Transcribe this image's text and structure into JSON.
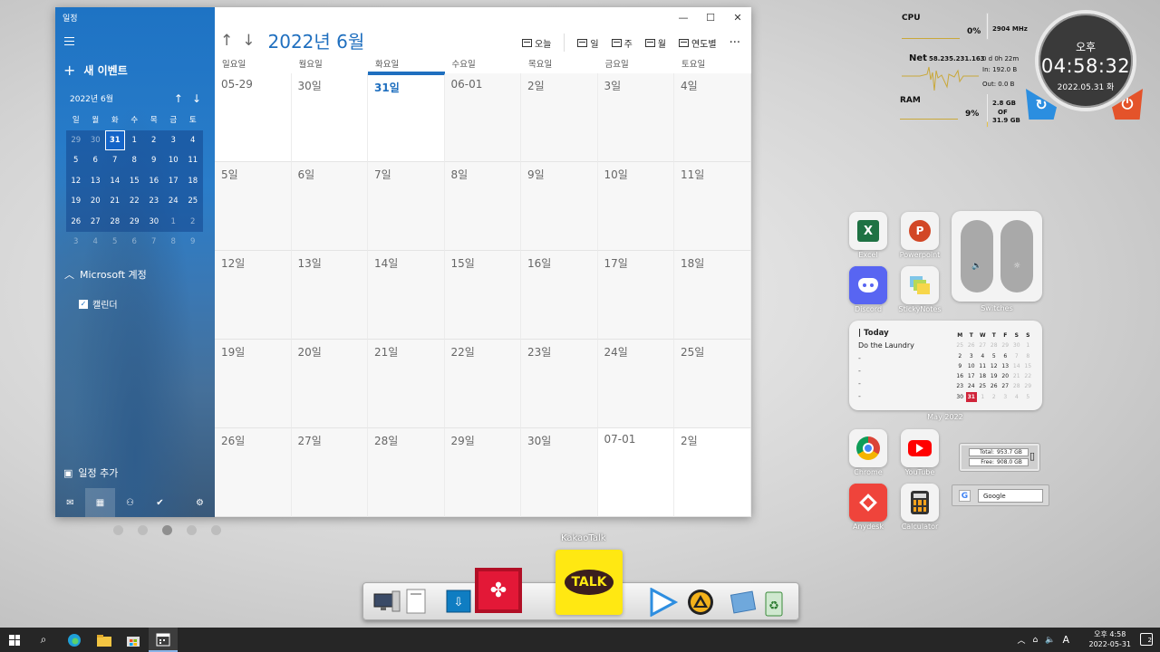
{
  "app": {
    "title": "일정"
  },
  "sidebar": {
    "new_event": "새 이벤트",
    "mini_calendar": {
      "title": "2022년 6월",
      "weekdays": [
        "일",
        "월",
        "화",
        "수",
        "목",
        "금",
        "토"
      ],
      "days": [
        "29",
        "30",
        "31",
        "1",
        "2",
        "3",
        "4",
        "5",
        "6",
        "7",
        "8",
        "9",
        "10",
        "11",
        "12",
        "13",
        "14",
        "15",
        "16",
        "17",
        "18",
        "19",
        "20",
        "21",
        "22",
        "23",
        "24",
        "25",
        "26",
        "27",
        "28",
        "29",
        "30",
        "1",
        "2",
        "3",
        "4",
        "5",
        "6",
        "7",
        "8",
        "9"
      ]
    },
    "account": "Microsoft 계정",
    "calendar_name": "캘린더",
    "add_calendar": "일정 추가"
  },
  "main": {
    "month_title": "2022년 6월",
    "toolbar": {
      "today": "오늘",
      "day": "일",
      "week": "주",
      "month": "월",
      "year": "연도별",
      "more": "···"
    },
    "weekdays": [
      "일요일",
      "월요일",
      "화요일",
      "수요일",
      "목요일",
      "금요일",
      "토요일"
    ],
    "cells": [
      "05-29",
      "30일",
      "31일",
      "06-01",
      "2일",
      "3일",
      "4일",
      "5일",
      "6일",
      "7일",
      "8일",
      "9일",
      "10일",
      "11일",
      "12일",
      "13일",
      "14일",
      "15일",
      "16일",
      "17일",
      "18일",
      "19일",
      "20일",
      "21일",
      "22일",
      "23일",
      "24일",
      "25일",
      "26일",
      "27일",
      "28일",
      "29일",
      "30일",
      "07-01",
      "2일"
    ]
  },
  "monitor": {
    "cpu_label": "CPU",
    "cpu_value": "0%",
    "cpu_freq": "2904 MHz",
    "net_label": "Net",
    "net_ip": "58.235.231.163",
    "net_uptime": "0 d 0h 22m",
    "net_in": "In: 192.0 B",
    "net_out": "Out: 0.0 B",
    "ram_label": "RAM",
    "ram_value": "9%",
    "ram_used": "2.8 GB",
    "ram_of": "OF",
    "ram_total": "31.9 GB"
  },
  "clock": {
    "ampm": "오후",
    "time": "04:58:32",
    "date": "2022.05.31 화"
  },
  "apps": {
    "excel": "Excel",
    "powerpoint": "Powerpoint",
    "discord": "Discord",
    "stickynotes": "StickyNotes",
    "switches": "Switches",
    "chrome": "Chrome",
    "youtube": "YouTube",
    "anydesk": "Anydesk",
    "calculator": "Calculator"
  },
  "todo_widget": {
    "title": "| Today",
    "item": "Do the Laundry",
    "dashes": [
      "-",
      "-",
      "-",
      "-"
    ],
    "caption": "May 2022",
    "weekdays": [
      "M",
      "T",
      "W",
      "T",
      "F",
      "S",
      "S"
    ],
    "days": [
      "25",
      "26",
      "27",
      "28",
      "29",
      "30",
      "1",
      "2",
      "3",
      "4",
      "5",
      "6",
      "7",
      "8",
      "9",
      "10",
      "11",
      "12",
      "13",
      "14",
      "15",
      "16",
      "17",
      "18",
      "19",
      "20",
      "21",
      "22",
      "23",
      "24",
      "25",
      "26",
      "27",
      "28",
      "29",
      "30",
      "31",
      "1",
      "2",
      "3",
      "4",
      "5"
    ]
  },
  "disk": {
    "total_label": "Total:",
    "total_value": "953.7 GB",
    "free_label": "Free:",
    "free_value": "908.0 GB"
  },
  "google": {
    "label": "Google"
  },
  "dock": {
    "label": "KakaoTalk",
    "talk": "TALK"
  },
  "taskbar": {
    "time": "오후 4:58",
    "date": "2022-05-31",
    "notifications": "2",
    "ime": "A"
  }
}
